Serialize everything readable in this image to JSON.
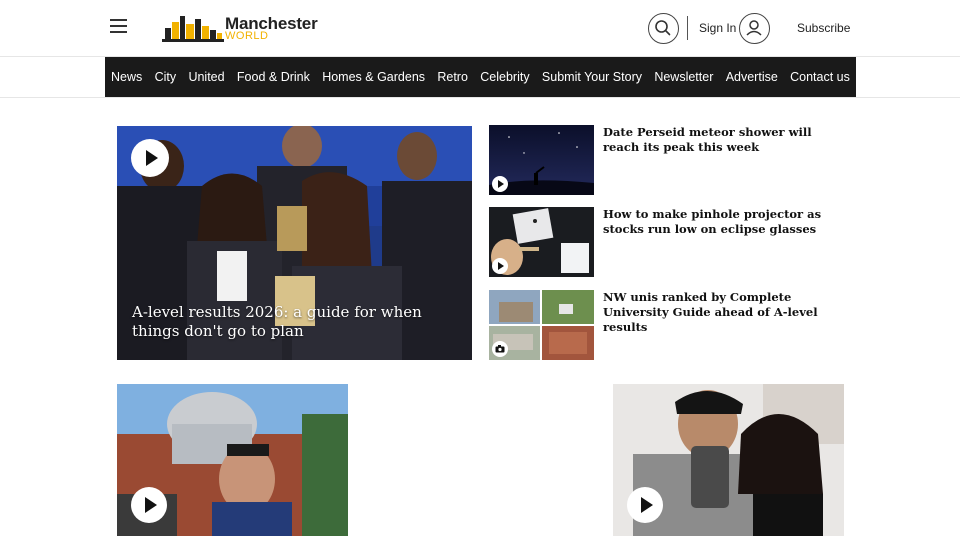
{
  "header": {
    "logo_line1": "Manchester",
    "logo_line2": "WORLD",
    "signin_label": "Sign In",
    "subscribe_label": "Subscribe"
  },
  "nav": {
    "items": [
      "News",
      "City",
      "United",
      "Food & Drink",
      "Homes & Gardens",
      "Retro",
      "Celebrity",
      "Submit Your Story",
      "Newsletter",
      "Advertise",
      "Contact us"
    ]
  },
  "hero": {
    "title": "A-level results 2026: a guide for when things don't go to plan",
    "media_icon": "play-icon"
  },
  "side_stories": [
    {
      "title": "Date Perseid meteor shower will reach its peak this week",
      "media_icon": "play-icon"
    },
    {
      "title": "How to make pinhole projector as stocks run low on eclipse glasses",
      "media_icon": "play-icon"
    },
    {
      "title": "NW unis ranked by Complete University Guide ahead of A-level results",
      "media_icon": "camera-icon"
    }
  ],
  "bottom_cards": [
    {
      "media_icon": "play-icon"
    },
    {
      "media_icon": "play-icon"
    }
  ],
  "colors": {
    "nav_bg": "#1a1a1a",
    "logo_accent": "#f2b200",
    "hero_bg": "#1f3b8a"
  }
}
